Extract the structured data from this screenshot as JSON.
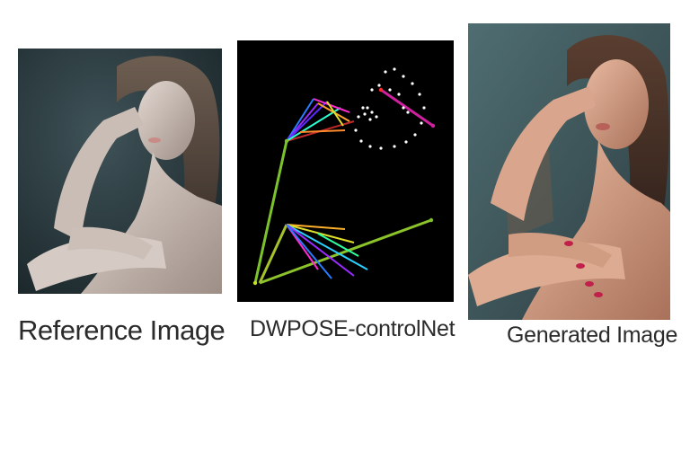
{
  "panels": [
    {
      "id": "reference",
      "caption": "Reference Image"
    },
    {
      "id": "pose",
      "caption": "DWPOSE-controlNet"
    },
    {
      "id": "generated",
      "caption": "Generated Image"
    }
  ],
  "colors": {
    "background": "#ffffff",
    "pose_background": "#000000",
    "caption_text": "#2b2b2b"
  }
}
